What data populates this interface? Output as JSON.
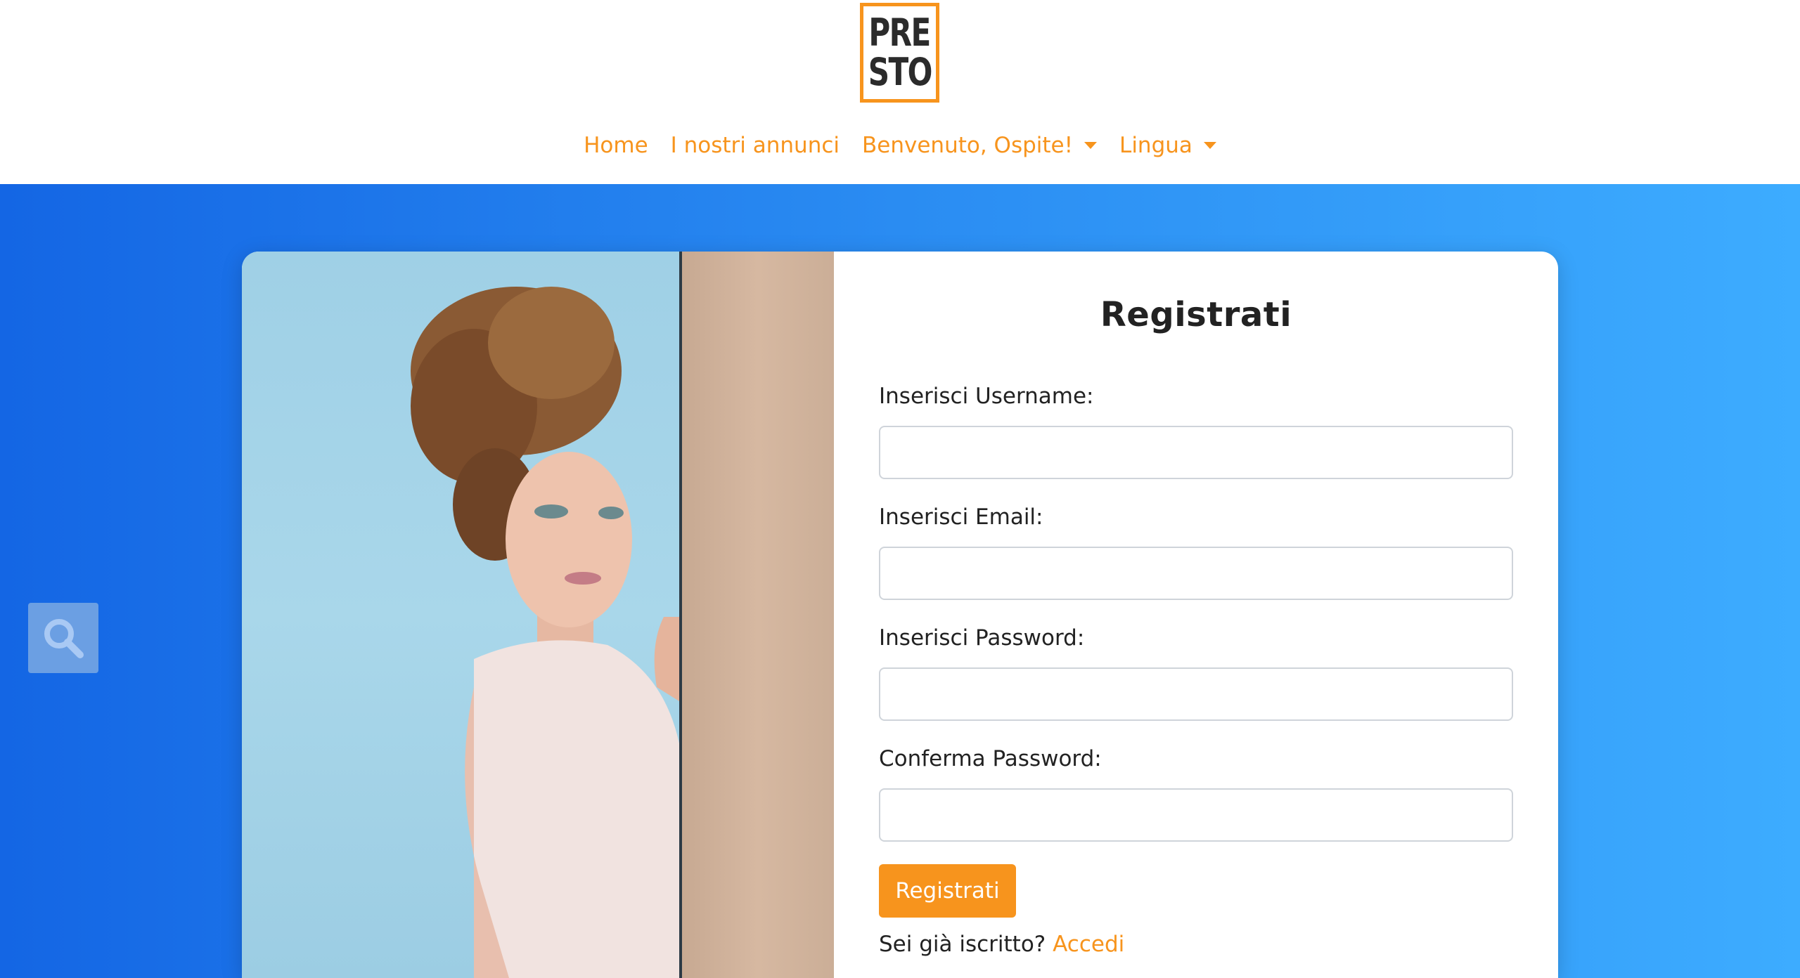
{
  "logo": {
    "line1": "PRE",
    "line2": "STO",
    "border_color": "#f7941d"
  },
  "nav": {
    "items": [
      {
        "label": "Home",
        "dropdown": false
      },
      {
        "label": "I nostri annunci",
        "dropdown": false
      },
      {
        "label": "Benvenuto, Ospite!",
        "dropdown": true
      },
      {
        "label": "Lingua",
        "dropdown": true
      }
    ],
    "color": "#f7941d"
  },
  "search_tile": {
    "icon": "search-icon"
  },
  "form": {
    "title": "Registrati",
    "fields": [
      {
        "label": "Inserisci Username:",
        "value": "",
        "placeholder": ""
      },
      {
        "label": "Inserisci Email:",
        "value": "",
        "placeholder": ""
      },
      {
        "label": "Inserisci Password:",
        "value": "",
        "placeholder": ""
      },
      {
        "label": "Conferma Password:",
        "value": "",
        "placeholder": ""
      }
    ],
    "submit_label": "Registrati",
    "login_prompt": "Sei già iscritto?",
    "login_link": "Accedi"
  },
  "colors": {
    "accent": "#f7941d",
    "hero_start": "#1466e4",
    "hero_end": "#3dacff"
  }
}
